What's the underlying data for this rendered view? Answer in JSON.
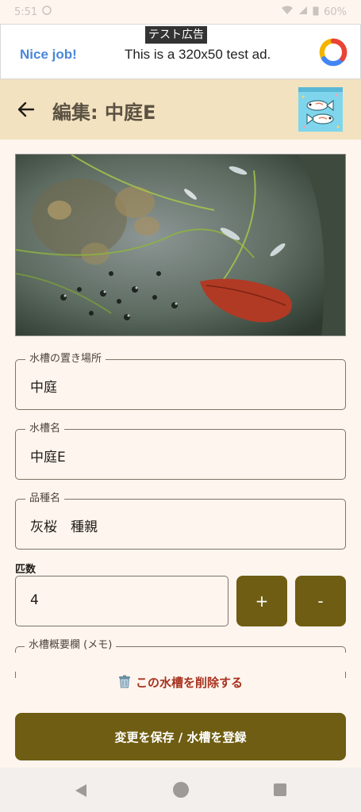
{
  "status_bar": {
    "time": "5:51",
    "battery": "60%"
  },
  "ad": {
    "label": "テスト広告",
    "nice_job": "Nice job!",
    "text": "This is a 320x50 test ad."
  },
  "app_bar": {
    "title": "編集: 中庭E"
  },
  "fields": {
    "location": {
      "label": "水槽の置き場所",
      "value": "中庭"
    },
    "tank_name": {
      "label": "水槽名",
      "value": "中庭E"
    },
    "variety": {
      "label": "品種名",
      "value": "灰桜　種親"
    }
  },
  "count": {
    "label": "匹数",
    "value": "4",
    "plus_label": "+",
    "minus_label": "-"
  },
  "memo": {
    "label": "水槽概要欄 (メモ)"
  },
  "delete_label": "この水槽を削除する",
  "save_label": "変更を保存 / 水槽を登録"
}
